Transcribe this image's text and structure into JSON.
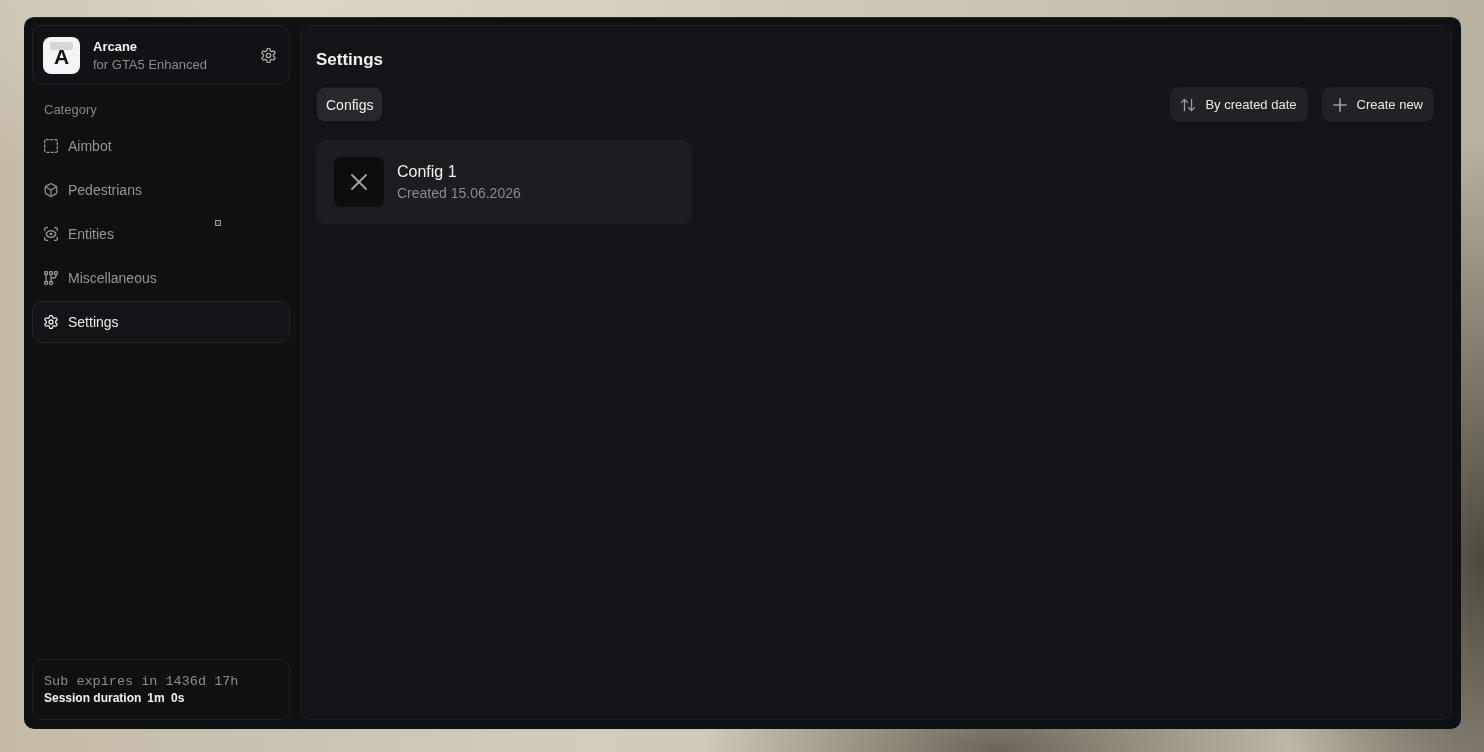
{
  "app": {
    "logo_letter": "A",
    "name": "Arcane",
    "subtitle": "for GTA5 Enhanced"
  },
  "sidebar": {
    "section_label": "Category",
    "items": [
      {
        "label": "Aimbot",
        "kind": "square",
        "selected": false
      },
      {
        "label": "Pedestrians",
        "kind": "cube",
        "selected": false
      },
      {
        "label": "Entities",
        "kind": "scan",
        "selected": false
      },
      {
        "label": "Miscellaneous",
        "kind": "nodes",
        "selected": false
      },
      {
        "label": "Settings",
        "kind": "gear",
        "selected": true
      }
    ]
  },
  "status": {
    "subscription": "Sub expires in 1436d 17h",
    "session_label": "Session duration",
    "session_value": "1m 0s"
  },
  "main": {
    "title": "Settings",
    "tabs": [
      {
        "label": "Configs",
        "selected": true
      }
    ],
    "actions": [
      {
        "label": "By created date",
        "kind": "sort"
      },
      {
        "label": "Create new",
        "kind": "create"
      }
    ],
    "configs": [
      {
        "name": "Config 1",
        "created": "Created 15.06.2026"
      }
    ]
  }
}
